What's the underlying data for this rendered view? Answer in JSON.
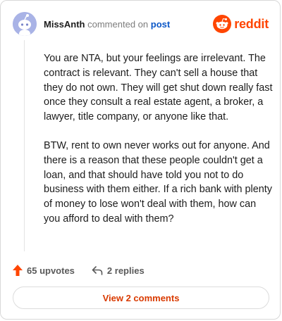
{
  "comment": {
    "username": "MissAnth",
    "action_text": "commented on",
    "post_link_text": "post",
    "paragraphs": [
      "You are NTA, but your feelings are irrelevant. The contract is relevant. They can't sell a house that they do not own. They will get shut down really fast once they consult a real estate agent, a broker, a lawyer, title company, or anyone like that.",
      "BTW, rent to own never works out for anyone. And there is a reason that these people couldn't get a loan, and that should have told you not to do business with them either. If a rich bank with plenty of money to lose won't deal with them, how can you afford to deal with them?"
    ]
  },
  "logo": {
    "text": "reddit",
    "icon": "reddit-snoo-icon",
    "color": "#ff4500"
  },
  "actions": {
    "upvotes_label": "65 upvotes",
    "upvote_icon": "upvote-arrow-icon",
    "upvote_color": "#ff4500",
    "replies_label": "2 replies",
    "reply_icon": "reply-arrow-icon"
  },
  "view_comments": {
    "label": "View 2 comments",
    "color": "#d93a00"
  },
  "avatar": {
    "icon": "snoo-avatar-icon",
    "background": "#a9b3e6"
  }
}
